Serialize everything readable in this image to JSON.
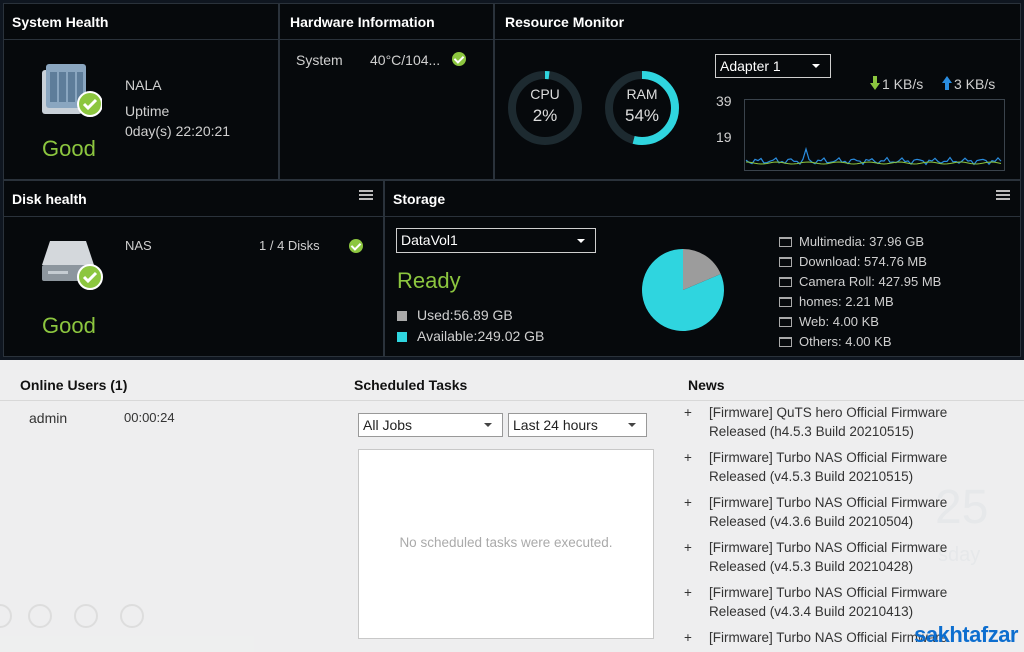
{
  "system_health": {
    "title": "System Health",
    "device_name": "NALA",
    "uptime_label": "Uptime",
    "uptime_value": "0day(s) 22:20:21",
    "status": "Good"
  },
  "hardware_info": {
    "title": "Hardware Information",
    "label": "System",
    "value": "40°C/104..."
  },
  "resource_monitor": {
    "title": "Resource Monitor",
    "cpu_label": "CPU",
    "cpu_value": "2%",
    "cpu_fraction": 0.02,
    "ram_label": "RAM",
    "ram_value": "54%",
    "ram_fraction": 0.54,
    "adapter": "Adapter 1",
    "download": "1 KB/s",
    "upload": "3 KB/s",
    "axis_top": "39",
    "axis_mid": "19"
  },
  "disk_health": {
    "title": "Disk health",
    "label": "NAS",
    "disks": "1 / 4 Disks",
    "status": "Good"
  },
  "storage": {
    "title": "Storage",
    "volume": "DataVol1",
    "status": "Ready",
    "used": "Used:56.89 GB",
    "available": "Available:249.02 GB",
    "used_fraction": 0.186,
    "folders": [
      "Multimedia: 37.96 GB",
      "Download: 574.76 MB",
      "Camera Roll: 427.95 MB",
      "homes: 2.21 MB",
      "Web: 4.00 KB",
      "Others: 4.00 KB"
    ]
  },
  "online_users": {
    "title": "Online Users (1)",
    "user": "admin",
    "time": "00:00:24"
  },
  "scheduled_tasks": {
    "title": "Scheduled Tasks",
    "filter_jobs": "All Jobs",
    "filter_time": "Last 24 hours",
    "empty": "No scheduled tasks were executed."
  },
  "news": {
    "title": "News",
    "items": [
      "[Firmware] QuTS hero Official Firmware Released (h4.5.3 Build 20210515)",
      "[Firmware] Turbo NAS Official Firmware Released (v4.5.3 Build 20210515)",
      "[Firmware] Turbo NAS Official Firmware Released (v4.3.6 Build 20210504)",
      "[Firmware] Turbo NAS Official Firmware Released (v4.5.3 Build 20210428)",
      "[Firmware] Turbo NAS Official Firmware Released (v4.3.4 Build 20210413)",
      "[Firmware] Turbo NAS Official Firmware"
    ]
  },
  "background": {
    "clock": "25",
    "day": "sday"
  },
  "watermark": "sakhtafzar",
  "colors": {
    "good": "#8cc63f",
    "accent": "#2fd5df",
    "panel_bg": "#06090c",
    "border": "#2a323b"
  }
}
